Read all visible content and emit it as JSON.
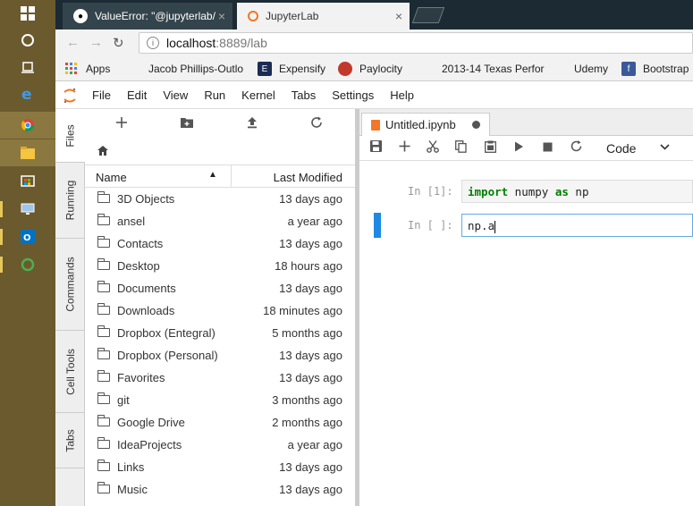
{
  "browser": {
    "tabs": [
      {
        "title": "ValueError: \"@jupyterlab/",
        "active": false
      },
      {
        "title": "JupyterLab",
        "active": true
      }
    ],
    "url_host": "localhost",
    "url_path": ":8889/lab"
  },
  "bookmarks": [
    {
      "label": "Apps",
      "icon": "apps-grid-icon"
    },
    {
      "label": "Jacob Phillips-Outlo",
      "icon": "blank-page-icon"
    },
    {
      "label": "Expensify",
      "icon": "expensify-icon"
    },
    {
      "label": "Paylocity",
      "icon": "paylocity-icon"
    },
    {
      "label": "2013-14 Texas Perfor",
      "icon": "blank-page-icon"
    },
    {
      "label": "Udemy",
      "icon": "blank-page-icon"
    },
    {
      "label": "Bootstrap",
      "icon": "facebook-icon"
    }
  ],
  "jupyter": {
    "menu": [
      "File",
      "Edit",
      "View",
      "Run",
      "Kernel",
      "Tabs",
      "Settings",
      "Help"
    ],
    "sidebar_tabs": [
      "Files",
      "Running",
      "Commands",
      "Cell Tools",
      "Tabs"
    ],
    "filebrowser": {
      "col_name": "Name",
      "col_modified": "Last Modified",
      "files": [
        {
          "name": "3D Objects",
          "modified": "13 days ago"
        },
        {
          "name": "ansel",
          "modified": "a year ago"
        },
        {
          "name": "Contacts",
          "modified": "13 days ago"
        },
        {
          "name": "Desktop",
          "modified": "18 hours ago"
        },
        {
          "name": "Documents",
          "modified": "13 days ago"
        },
        {
          "name": "Downloads",
          "modified": "18 minutes ago"
        },
        {
          "name": "Dropbox (Entegral)",
          "modified": "5 months ago"
        },
        {
          "name": "Dropbox (Personal)",
          "modified": "13 days ago"
        },
        {
          "name": "Favorites",
          "modified": "13 days ago"
        },
        {
          "name": "git",
          "modified": "3 months ago"
        },
        {
          "name": "Google Drive",
          "modified": "2 months ago"
        },
        {
          "name": "IdeaProjects",
          "modified": "a year ago"
        },
        {
          "name": "Links",
          "modified": "13 days ago"
        },
        {
          "name": "Music",
          "modified": "13 days ago"
        }
      ]
    },
    "notebook": {
      "tab_title": "Untitled.ipynb",
      "cell_type": "Code",
      "cells": [
        {
          "prompt": "In [1]:",
          "kw1": "import",
          "mid": " numpy ",
          "kw2": "as",
          "end": " np"
        },
        {
          "prompt": "In [ ]:",
          "code": "np.a"
        }
      ]
    }
  },
  "colors": {
    "jupyter_orange": "#f37726",
    "active_cell": "#1e88e5",
    "keyword": "#008000"
  }
}
